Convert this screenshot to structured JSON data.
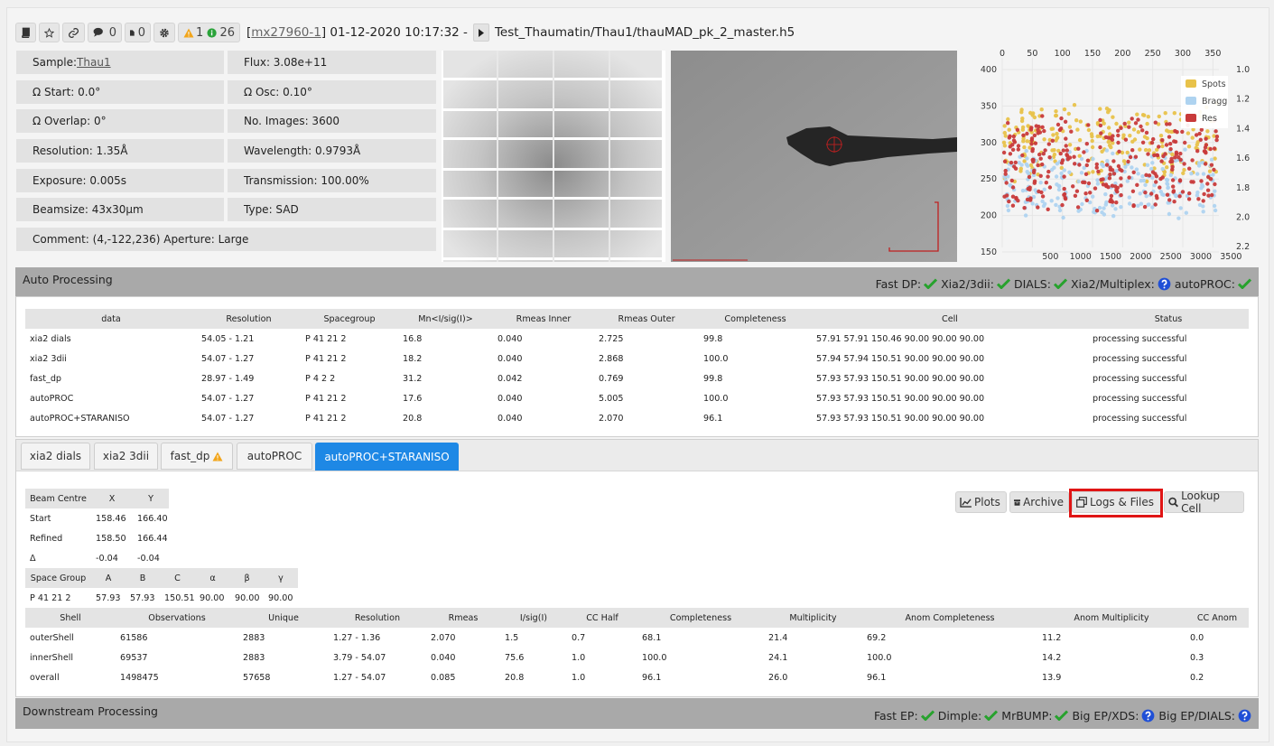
{
  "toolbar": {
    "comments": "0",
    "attachments": "0",
    "warnings": "1",
    "infos": "26",
    "visit": "mx27960-1",
    "datetime": "01-12-2020 10:17:32 -",
    "filename": "Test_Thaumatin/Thau1/thauMAD_pk_2_master.h5"
  },
  "params": {
    "sample_label": "Sample: ",
    "sample_value": "Thau1",
    "flux": "Flux: 3.08e+11",
    "omega_start": "Ω Start: 0.0°",
    "omega_osc": "Ω Osc: 0.10°",
    "omega_overlap": "Ω Overlap: 0°",
    "no_images": "No. Images: 3600",
    "resolution": "Resolution: 1.35Å",
    "wavelength": "Wavelength: 0.9793Å",
    "exposure": "Exposure: 0.005s",
    "transmission": "Transmission: 100.00%",
    "beamsize": "Beamsize: 43x30µm",
    "type": "Type: SAD",
    "comment": "Comment: (4,-122,236) Aperture: Large"
  },
  "plot": {
    "top_ticks": [
      "0",
      "50",
      "100",
      "150",
      "200",
      "250",
      "300",
      "350"
    ],
    "left_ticks": [
      "400",
      "350",
      "300",
      "250",
      "200",
      "150"
    ],
    "right_ticks": [
      "1.0",
      "1.2",
      "1.4",
      "1.6",
      "1.8",
      "2.0",
      "2.2"
    ],
    "bottom_ticks": [
      "500",
      "1000",
      "1500",
      "2000",
      "2500",
      "3000",
      "3500"
    ],
    "legend": [
      {
        "label": "Spots",
        "color": "#e8c24a"
      },
      {
        "label": "Bragg",
        "color": "#aed3f0"
      },
      {
        "label": "Res",
        "color": "#c83a3a"
      }
    ]
  },
  "auto_processing": {
    "title": "Auto Processing",
    "status_items": [
      {
        "label": "Fast DP:",
        "state": "ok"
      },
      {
        "label": "Xia2/3dii:",
        "state": "ok"
      },
      {
        "label": "DIALS:",
        "state": "ok"
      },
      {
        "label": "Xia2/Multiplex:",
        "state": "unknown"
      },
      {
        "label": "autoPROC:",
        "state": "ok"
      }
    ],
    "columns": [
      "data",
      "Resolution",
      "Spacegroup",
      "Mn<I/sig(I)>",
      "Rmeas Inner",
      "Rmeas Outer",
      "Completeness",
      "Cell",
      "Status"
    ],
    "rows": [
      [
        "xia2 dials",
        "54.05 - 1.21",
        "P 41 21 2",
        "16.8",
        "0.040",
        "2.725",
        "99.8",
        "57.91 57.91 150.46 90.00 90.00 90.00",
        "processing successful"
      ],
      [
        "xia2 3dii",
        "54.07 - 1.27",
        "P 41 21 2",
        "18.2",
        "0.040",
        "2.868",
        "100.0",
        "57.94 57.94 150.51 90.00 90.00 90.00",
        "processing successful"
      ],
      [
        "fast_dp",
        "28.97 - 1.49",
        "P 4 2 2",
        "31.2",
        "0.042",
        "0.769",
        "99.8",
        "57.93 57.93 150.51 90.00 90.00 90.00",
        "processing successful"
      ],
      [
        "autoPROC",
        "54.07 - 1.27",
        "P 41 21 2",
        "17.6",
        "0.040",
        "5.005",
        "100.0",
        "57.93 57.93 150.51 90.00 90.00 90.00",
        "processing successful"
      ],
      [
        "autoPROC+STARANISO",
        "54.07 - 1.27",
        "P 41 21 2",
        "20.8",
        "0.040",
        "2.070",
        "96.1",
        "57.93 57.93 150.51 90.00 90.00 90.00",
        "processing successful"
      ]
    ]
  },
  "tabs": [
    "xia2 dials",
    "xia2 3dii",
    "fast_dp",
    "autoPROC",
    "autoPROC+STARANISO"
  ],
  "actions": {
    "plots": "Plots",
    "archive": "Archive",
    "logs": "Logs & Files",
    "lookup": "Lookup Cell"
  },
  "beam": {
    "headers": [
      "Beam Centre",
      "X",
      "Y"
    ],
    "rows": [
      [
        "Start",
        "158.46",
        "166.40"
      ],
      [
        "Refined",
        "158.50",
        "166.44"
      ],
      [
        "Δ",
        "-0.04",
        "-0.04"
      ]
    ]
  },
  "cell": {
    "headers": [
      "Space Group",
      "A",
      "B",
      "C",
      "α",
      "β",
      "γ"
    ],
    "row": [
      "P 41 21 2",
      "57.93",
      "57.93",
      "150.51",
      "90.00",
      "90.00",
      "90.00"
    ]
  },
  "shells": {
    "headers": [
      "Shell",
      "Observations",
      "Unique",
      "Resolution",
      "Rmeas",
      "I/sig(I)",
      "CC Half",
      "Completeness",
      "Multiplicity",
      "Anom Completeness",
      "Anom Multiplicity",
      "CC Anom"
    ],
    "rows": [
      [
        "outerShell",
        "61586",
        "2883",
        "1.27 - 1.36",
        "2.070",
        "1.5",
        "0.7",
        "68.1",
        "21.4",
        "69.2",
        "11.2",
        "0.0"
      ],
      [
        "innerShell",
        "69537",
        "2883",
        "3.79 - 54.07",
        "0.040",
        "75.6",
        "1.0",
        "100.0",
        "24.1",
        "100.0",
        "14.2",
        "0.3"
      ],
      [
        "overall",
        "1498475",
        "57658",
        "1.27 - 54.07",
        "0.085",
        "20.8",
        "1.0",
        "96.1",
        "26.0",
        "96.1",
        "13.9",
        "0.2"
      ]
    ]
  },
  "downstream": {
    "title": "Downstream Processing",
    "status_items": [
      {
        "label": "Fast EP:",
        "state": "ok"
      },
      {
        "label": "Dimple:",
        "state": "ok"
      },
      {
        "label": "MrBUMP:",
        "state": "ok"
      },
      {
        "label": "Big EP/XDS:",
        "state": "unknown"
      },
      {
        "label": "Big EP/DIALS:",
        "state": "unknown"
      }
    ]
  }
}
